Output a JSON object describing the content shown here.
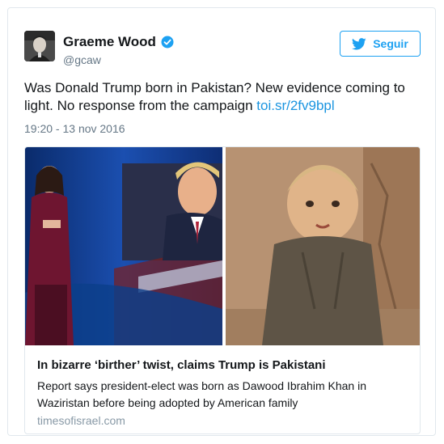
{
  "user": {
    "name": "Graeme Wood",
    "handle": "@gcaw"
  },
  "follow_button": {
    "label": "Seguir"
  },
  "tweet": {
    "text": "Was Donald Trump born in Pakistan? New evidence coming to light. No response from the campaign ",
    "link": "toi.sr/2fv9bpl",
    "timestamp": "19:20 - 13 nov 2016"
  },
  "card": {
    "title": "In bizarre ‘birther’ twist, claims Trump is Pakistani",
    "description": "Report says president-elect was born as Dawood Ibrahim Khan in Waziristan before being adopted by American family",
    "domain": "timesofisrael.com"
  },
  "colors": {
    "accent": "#1da1f2",
    "link": "#1b95e0",
    "secondary_text": "#657786",
    "border": "#e1e8ed"
  },
  "icons": {
    "verified": "verified-badge-icon",
    "follow": "twitter-bird-icon"
  }
}
